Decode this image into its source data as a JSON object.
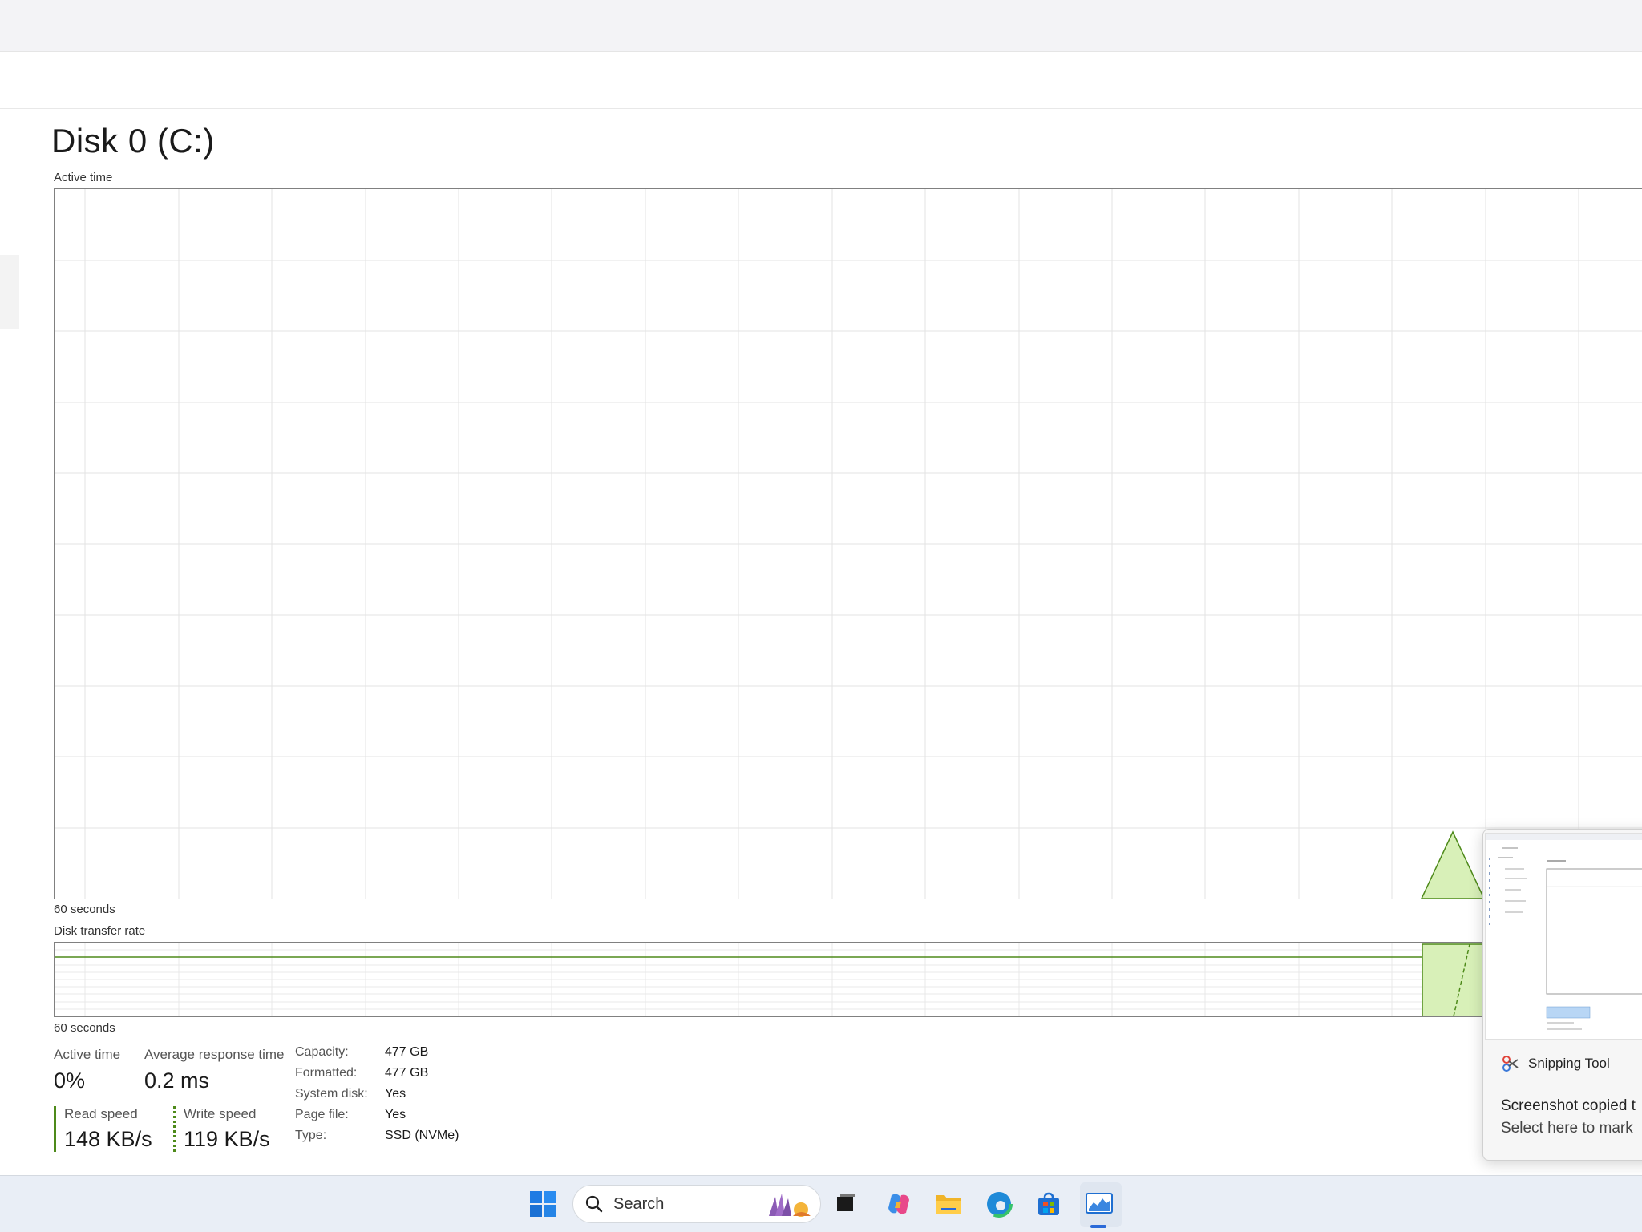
{
  "disk": {
    "title": "Disk 0 (C:)",
    "active_time_label": "Active time",
    "time_span_label": "60 seconds",
    "transfer_rate_label": "Disk transfer rate",
    "time_span_label_2": "60 seconds"
  },
  "stats": {
    "active_time_label": "Active time",
    "active_time_value": "0%",
    "avg_response_label": "Average response time",
    "avg_response_value": "0.2 ms",
    "read_speed_label": "Read speed",
    "read_speed_value": "148 KB/s",
    "write_speed_label": "Write speed",
    "write_speed_value": "119 KB/s"
  },
  "properties": [
    {
      "key": "Capacity:",
      "value": "477 GB"
    },
    {
      "key": "Formatted:",
      "value": "477 GB"
    },
    {
      "key": "System disk:",
      "value": "Yes"
    },
    {
      "key": "Page file:",
      "value": "Yes"
    },
    {
      "key": "Type:",
      "value": "SSD (NVMe)"
    }
  ],
  "toast": {
    "app_name": "Snipping Tool",
    "line1": "Screenshot copied t",
    "line2": "Select here to mark"
  },
  "taskbar": {
    "search_placeholder": "Search",
    "icons": [
      "windows-start-icon",
      "search-icon",
      "task-view-icon",
      "copilot-icon",
      "file-explorer-icon",
      "edge-icon",
      "store-icon",
      "task-manager-icon"
    ]
  },
  "colors": {
    "graph_line": "#4e8a1a",
    "graph_fill": "#d8f0b8",
    "grid": "#e3e3e3"
  }
}
